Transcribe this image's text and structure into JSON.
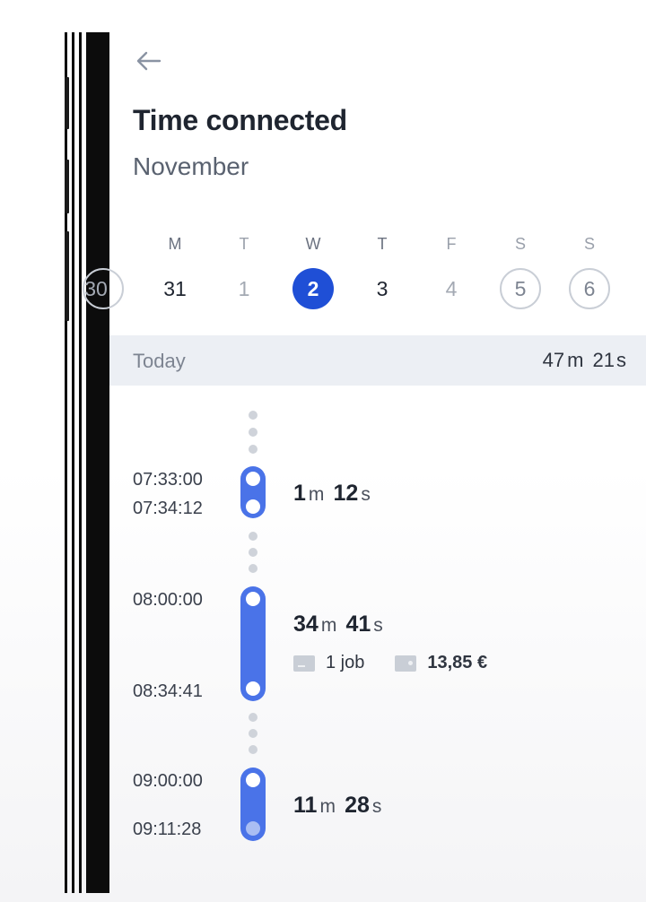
{
  "header": {
    "title": "Time connected",
    "month": "November"
  },
  "week": {
    "prev_partial": "30",
    "days": [
      {
        "name": "M",
        "num": "31"
      },
      {
        "name": "T",
        "num": "1"
      },
      {
        "name": "W",
        "num": "2"
      },
      {
        "name": "T",
        "num": "3"
      },
      {
        "name": "F",
        "num": "4"
      },
      {
        "name": "S",
        "num": "5"
      },
      {
        "name": "S",
        "num": "6"
      }
    ]
  },
  "today": {
    "label": "Today",
    "total_m": "47",
    "m_unit": "m",
    "total_s": "21",
    "s_unit": "s"
  },
  "sessions": [
    {
      "start": "07:33:00",
      "end": "07:34:12",
      "min": "1",
      "min_unit": "m",
      "sec": "12",
      "sec_unit": "s"
    },
    {
      "start": "08:00:00",
      "end": "08:34:41",
      "min": "34",
      "min_unit": "m",
      "sec": "41",
      "sec_unit": "s",
      "jobs": "1 job",
      "amount": "13,85 €"
    },
    {
      "start": "09:00:00",
      "end": "09:11:28",
      "min": "11",
      "min_unit": "m",
      "sec": "28",
      "sec_unit": "s"
    }
  ],
  "colors": {
    "accent": "#1f4fd6",
    "timeline": "#4a73e8",
    "track_dots": "#cfd3da"
  },
  "icons": {
    "back": "arrow-left",
    "job": "briefcase",
    "earnings": "wallet"
  }
}
